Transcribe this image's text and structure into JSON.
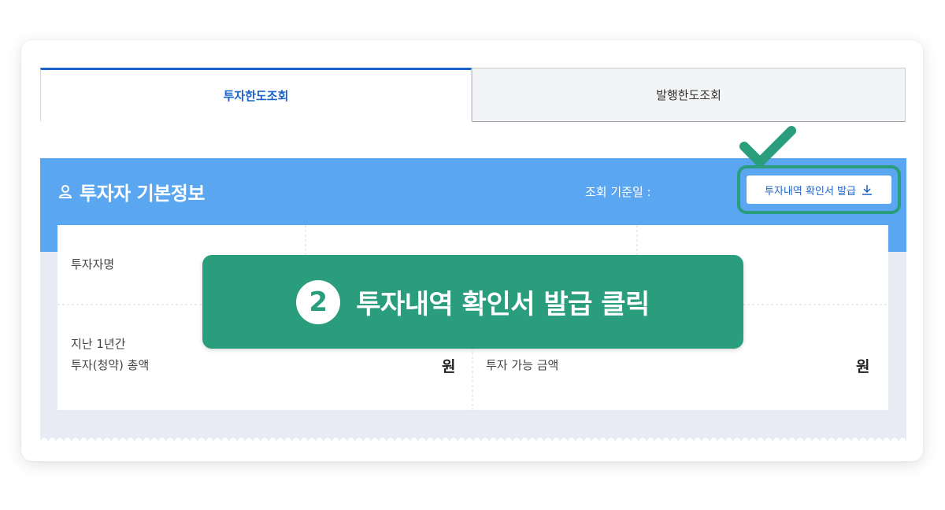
{
  "tabs": [
    {
      "label": "투자한도조회",
      "active": true
    },
    {
      "label": "발행한도조회",
      "active": false
    }
  ],
  "panel": {
    "title": "투자자 기본정보",
    "title_icon": "user-icon",
    "date_label": "조회 기준일 :",
    "issue_button": {
      "label": "투자내역 확인서 발급",
      "icon": "download-icon"
    }
  },
  "table": {
    "investor_name_label": "투자자명",
    "total_label_line1": "지난 1년간",
    "total_label_line2": "투자(청약) 총액",
    "total_unit": "원",
    "available_label_line2": "투자 가능 금액",
    "available_unit": "원"
  },
  "callout": {
    "step": "2",
    "text": "투자내역 확인서 발급 클릭"
  },
  "colors": {
    "tab_active": "#1a63c9",
    "panel_header": "#5aa6f0",
    "callout_green": "#2a9d7c"
  }
}
